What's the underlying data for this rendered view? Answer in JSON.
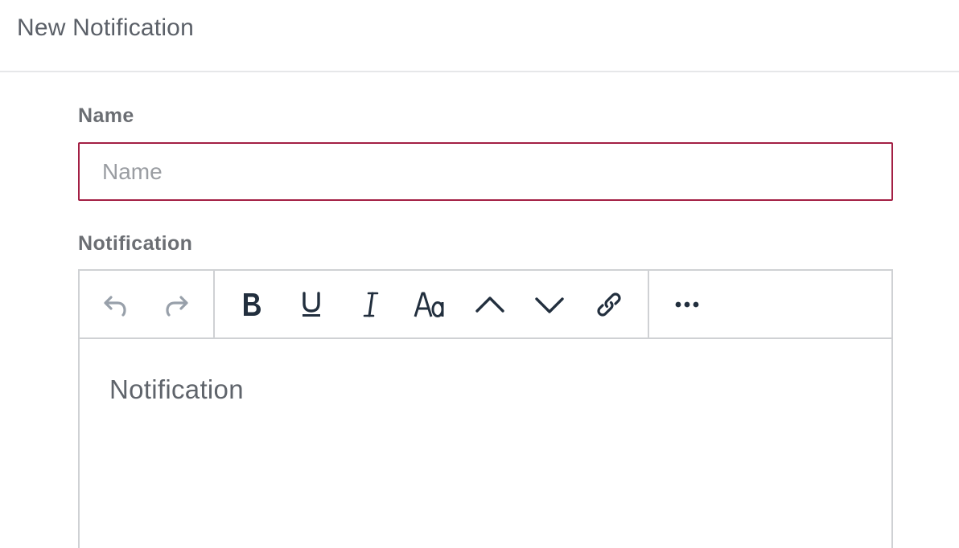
{
  "header": {
    "title": "New Notification"
  },
  "form": {
    "name_label": "Name",
    "name_placeholder": "Name",
    "name_value": "",
    "notification_label": "Notification",
    "notification_placeholder": "Notification"
  },
  "toolbar": {
    "buttons": [
      {
        "name": "undo",
        "icon": "undo-icon"
      },
      {
        "name": "redo",
        "icon": "redo-icon"
      },
      {
        "name": "bold",
        "icon": "bold-icon"
      },
      {
        "name": "underline",
        "icon": "underline-icon"
      },
      {
        "name": "italic",
        "icon": "italic-icon"
      },
      {
        "name": "font-size",
        "icon": "font-size-icon"
      },
      {
        "name": "superscript",
        "icon": "chevron-up-icon"
      },
      {
        "name": "subscript",
        "icon": "chevron-down-icon"
      },
      {
        "name": "link",
        "icon": "link-icon"
      },
      {
        "name": "more",
        "icon": "more-icon"
      }
    ]
  },
  "colors": {
    "input_border_error": "#a31f44",
    "icon_dark": "#222f3e",
    "icon_disabled": "#98a0aa",
    "border": "#cfd1d4"
  }
}
